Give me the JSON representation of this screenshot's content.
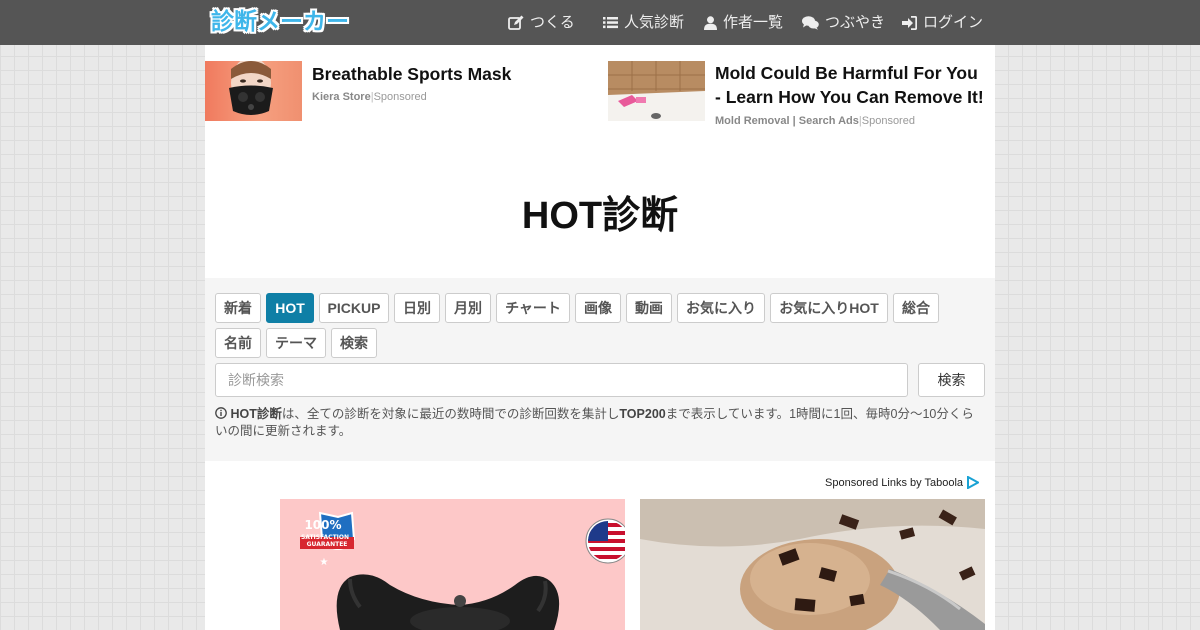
{
  "header": {
    "logo": "診断メーカー",
    "nav": [
      {
        "icon": "edit-icon",
        "label": "つくる"
      },
      {
        "icon": "list-icon",
        "label": "人気診断"
      },
      {
        "icon": "user-icon",
        "label": "作者一覧"
      },
      {
        "icon": "comments-icon",
        "label": "つぶやき"
      },
      {
        "icon": "sign-in-icon",
        "label": "ログイン"
      }
    ]
  },
  "ads": [
    {
      "title": "Breathable Sports Mask",
      "source": "Kiera Store",
      "tag": "Sponsored"
    },
    {
      "title_line1": "Mold Could Be Harmful For You",
      "title_line2": "- Learn How You Can Remove It!",
      "source": "Mold Removal | Search Ads",
      "tag": "Sponsored"
    }
  ],
  "page_title": "HOT診断",
  "tabs": [
    {
      "label": "新着",
      "active": false
    },
    {
      "label": "HOT",
      "active": true
    },
    {
      "label": "PICKUP",
      "active": false
    },
    {
      "label": "日別",
      "active": false
    },
    {
      "label": "月別",
      "active": false
    },
    {
      "label": "チャート",
      "active": false
    },
    {
      "label": "画像",
      "active": false
    },
    {
      "label": "動画",
      "active": false
    },
    {
      "label": "お気に入り",
      "active": false
    },
    {
      "label": "お気に入りHOT",
      "active": false
    },
    {
      "label": "総合",
      "active": false
    },
    {
      "label": "名前",
      "active": false
    },
    {
      "label": "テーマ",
      "active": false
    },
    {
      "label": "検索",
      "active": false
    }
  ],
  "search": {
    "placeholder": "診断検索",
    "button": "検索"
  },
  "info": {
    "bold1": "HOT診断",
    "text1": "は、全ての診断を対象に最近の数時間での診断回数を集計し",
    "bold2": "TOP200",
    "text2": "まで表示しています。1時間に1回、毎時0分～10分くらいの間に更新されます。"
  },
  "sponsored_links": "Sponsored Links by Taboola",
  "promo_badge": {
    "line1": "100%",
    "line2": "SATISFACTION",
    "line3": "GUARANTEE"
  },
  "colors": {
    "navbar": "#555555",
    "logo": "#3fb6ea",
    "active_tab": "#0f7fa6",
    "panel": "#f5f5f5"
  }
}
